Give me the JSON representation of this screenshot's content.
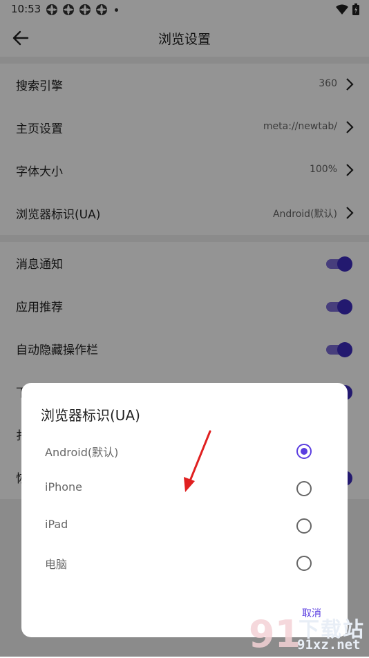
{
  "status_bar": {
    "time": "10:53"
  },
  "app_bar": {
    "title": "浏览设置"
  },
  "settings": [
    {
      "label": "搜索引擎",
      "value": "360"
    },
    {
      "label": "主页设置",
      "value": "meta://newtab/"
    },
    {
      "label": "字体大小",
      "value": "100%"
    },
    {
      "label": "浏览器标识(UA)",
      "value": "Android(默认)"
    }
  ],
  "toggles": [
    {
      "label": "消息通知",
      "on": true
    },
    {
      "label": "应用推荐",
      "on": true
    },
    {
      "label": "自动隐藏操作栏",
      "on": true
    }
  ],
  "hidden_partial": {
    "row4_char": "下",
    "row5_char": "扌",
    "row6_char": "恢"
  },
  "dialog": {
    "title": "浏览器标识(UA)",
    "options": [
      {
        "label": "Android(默认)",
        "selected": true
      },
      {
        "label": "iPhone",
        "selected": false
      },
      {
        "label": "iPad",
        "selected": false
      },
      {
        "label": "电脑",
        "selected": false
      }
    ],
    "cancel": "取消"
  },
  "watermark": {
    "brand": "下载站",
    "site": "91xz.net"
  },
  "colors": {
    "accent": "#5b3ee0",
    "toggle_thumb": "#3d2bbf",
    "annotation_arrow": "#e02020"
  }
}
